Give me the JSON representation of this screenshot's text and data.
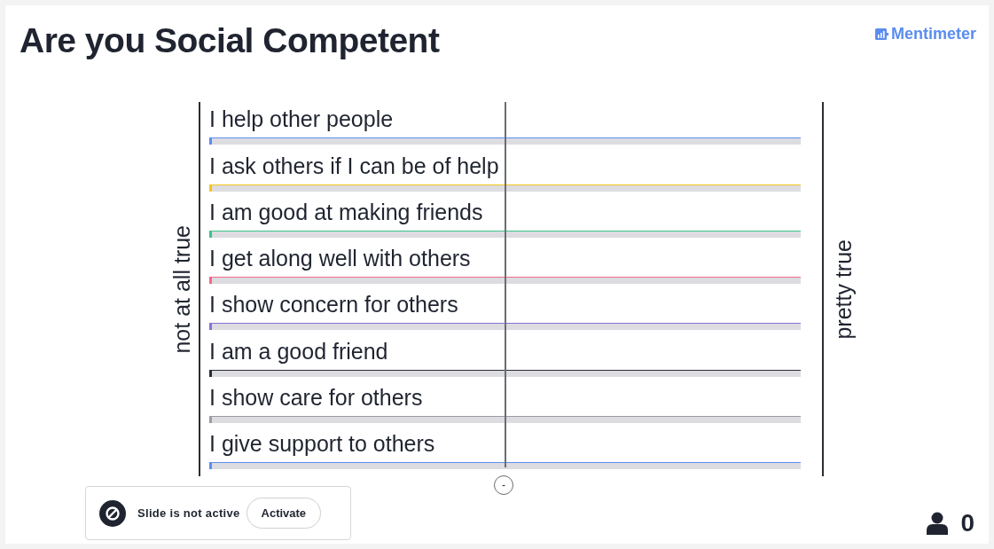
{
  "slide": {
    "title": "Are you Social Competent",
    "logo": "Mentimeter"
  },
  "scale": {
    "left_label": "not at all true",
    "right_label": "pretty true",
    "marker": "-"
  },
  "statements": [
    {
      "label": "I help other people",
      "color": "#5b8def"
    },
    {
      "label": "I ask others if I can be of help",
      "color": "#f5c518"
    },
    {
      "label": "I am good at making friends",
      "color": "#3cc48c"
    },
    {
      "label": "I get along well with others",
      "color": "#f06a8a"
    },
    {
      "label": "I show concern for others",
      "color": "#8a6fd6"
    },
    {
      "label": "I am a good friend",
      "color": "#2a2d34"
    },
    {
      "label": "I show care for others",
      "color": "#9a9ca3"
    },
    {
      "label": "I give support to others",
      "color": "#5b8def"
    }
  ],
  "status": {
    "message": "Slide is not active",
    "button": "Activate"
  },
  "participants": {
    "count": "0"
  }
}
